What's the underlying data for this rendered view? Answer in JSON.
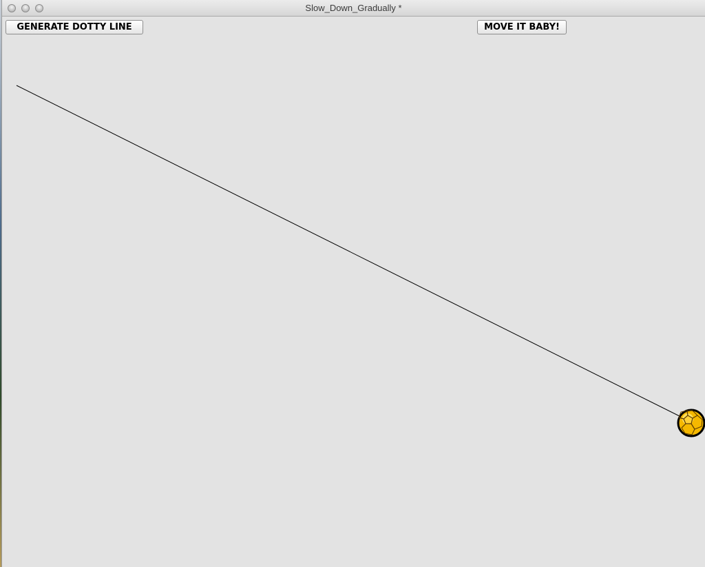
{
  "window": {
    "title": "Slow_Down_Gradually *"
  },
  "toolbar": {
    "generate_label": "GENERATE DOTTY LINE",
    "move_label": "MOVE IT BABY!"
  },
  "icons": {
    "window_controls": [
      "close-icon",
      "minimize-icon",
      "zoom-icon"
    ],
    "ball": "soccer-ball-icon"
  },
  "colors": {
    "canvas_background": "#e3e3e3",
    "line": "#000000",
    "ball_fill": "#f5b800",
    "ball_highlight": "#ffe46b",
    "ball_outline": "#000000"
  }
}
